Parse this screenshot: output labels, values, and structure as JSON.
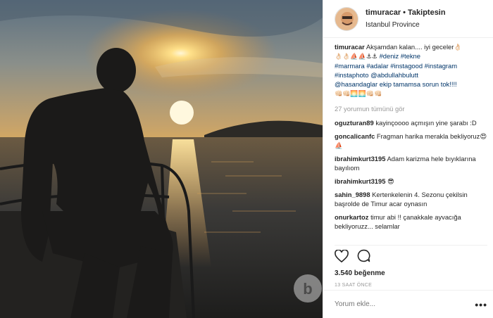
{
  "post": {
    "username": "timuracar",
    "separator": "•",
    "follow_label": "Takiptesin",
    "location": "Istanbul Province"
  },
  "caption": {
    "user": "timuracar",
    "text": "Akşamdan kalan.... iyi geceler👌🏻",
    "emoji_line": "👌🏻👌🏻⛵⛵⚓⚓",
    "tags_line1": "#deniz #tekne",
    "tags_line2": "#marmara #adalar #instagood #instagram",
    "tags_line3": "#instaphoto @abdullahbulutt",
    "mention_line": "@hasandaglar ekip tamamsa sorun tok!!!!",
    "emoji_line2": "👊🏻👊🏻🌅🌅👊🏻👊🏻"
  },
  "view_all_comments": "27 yorumun tümünü gör",
  "comments": [
    {
      "user": "oguzturan89",
      "text": "kayinçoooo açmışın yine şarabı :D"
    },
    {
      "user": "goncalicanfc",
      "text": "Fragman harika merakla bekliyoruz😍⛵"
    },
    {
      "user": "ibrahimkurt3195",
      "text": "Adam karizma hele bıyıklarına bayılıom"
    },
    {
      "user": "ibrahimkurt3195",
      "text": "😎"
    },
    {
      "user": "sahin_9898",
      "text": "Kertenkelenin 4. Sezonu çekilsin başrolde de Timur acar oynasın"
    },
    {
      "user": "onurkartoz",
      "text": "timur abi !! çanakkale ayvacığa bekliyoruzz... selamlar"
    }
  ],
  "actions": {
    "likes": "3.540 beğenme",
    "time": "13 SAAT ÖNCE",
    "like_icon": "heart-icon",
    "comment_icon": "comment-bubble-icon"
  },
  "add_comment": {
    "placeholder": "Yorum ekle...",
    "more_icon": "more-options-icon",
    "more_label": "•••"
  },
  "watermark": "b"
}
